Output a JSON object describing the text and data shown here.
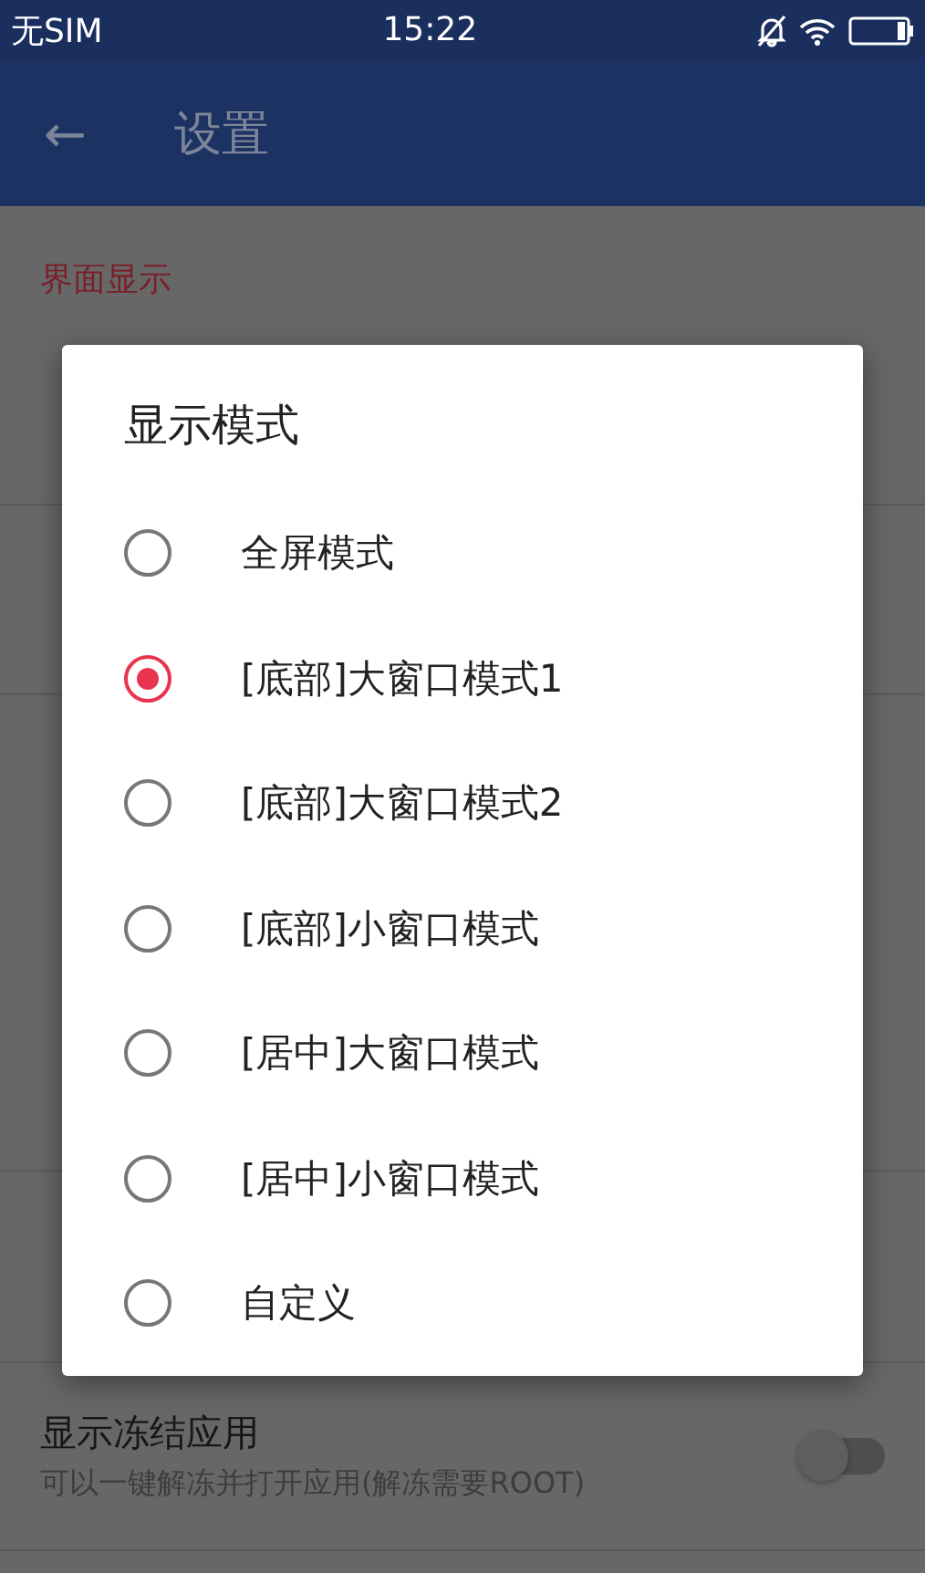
{
  "status_bar": {
    "carrier": "无SIM",
    "time": "15:22"
  },
  "app_bar": {
    "back": "←",
    "title": "设置"
  },
  "section_title": "界面显示",
  "settings": [
    {
      "kind": "switch",
      "title": "显示冻结应用",
      "subtitle": "可以一键解冻并打开应用(解冻需要ROOT)",
      "on": false
    }
  ],
  "dialog": {
    "title": "显示模式",
    "options": [
      {
        "label": "全屏模式",
        "selected": false
      },
      {
        "label": "[底部]大窗口模式1",
        "selected": true
      },
      {
        "label": "[底部]大窗口模式2",
        "selected": false
      },
      {
        "label": "[底部]小窗口模式",
        "selected": false
      },
      {
        "label": "[居中]大窗口模式",
        "selected": false
      },
      {
        "label": "[居中]小窗口模式",
        "selected": false
      },
      {
        "label": "自定义",
        "selected": false
      }
    ]
  }
}
